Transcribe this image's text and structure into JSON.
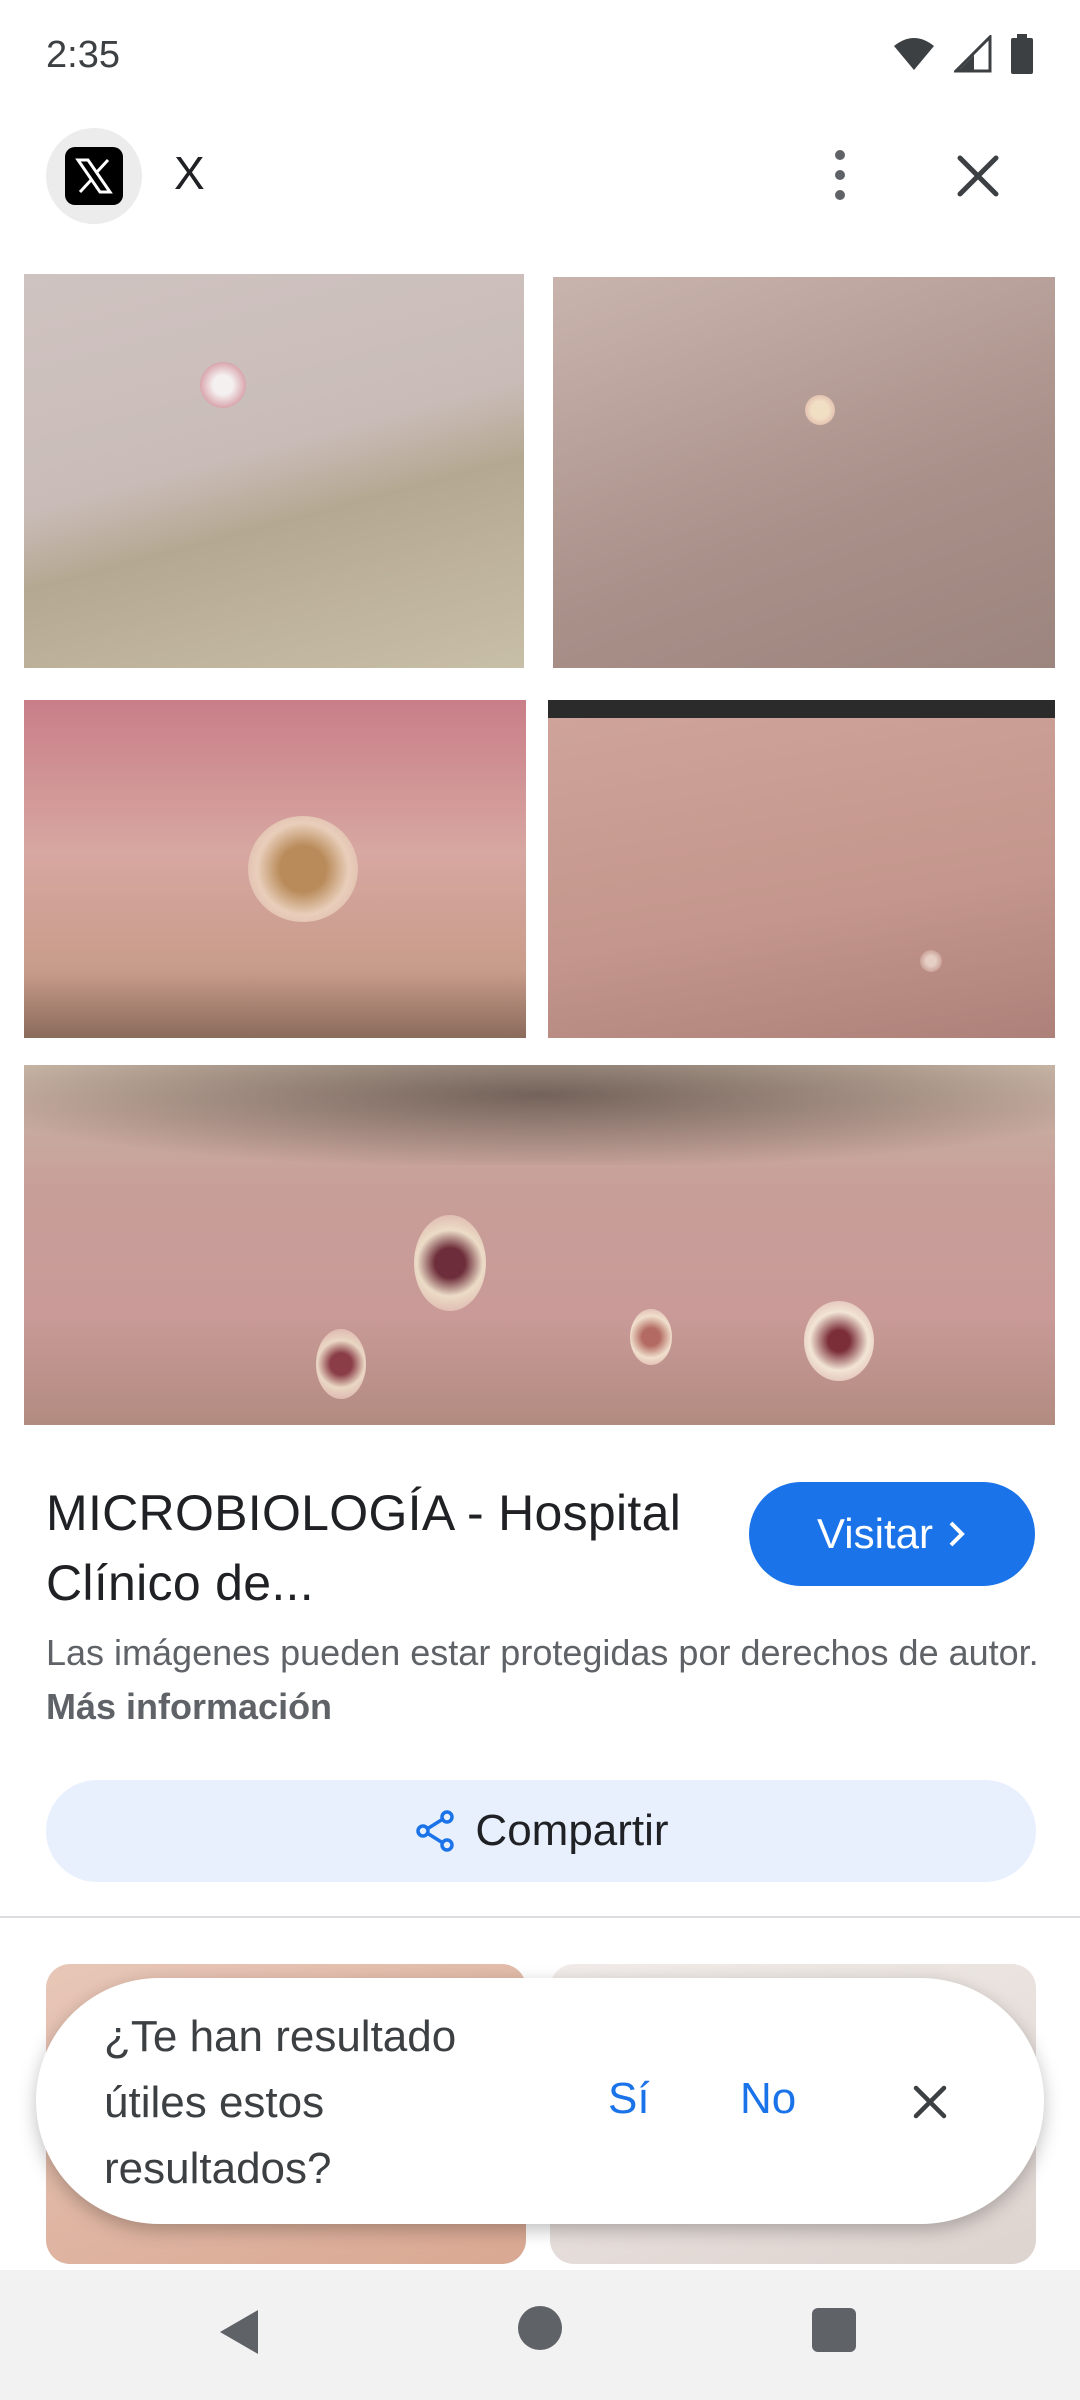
{
  "status_bar": {
    "time": "2:35",
    "icons": [
      "wifi-icon",
      "signal-icon",
      "battery-icon"
    ]
  },
  "header": {
    "source_name": "X",
    "source_icon": "x-logo-icon",
    "menu_icon": "more-vert-icon",
    "close_icon": "close-icon"
  },
  "images": [
    {
      "name": "lesion-photo-1"
    },
    {
      "name": "lesion-photo-2"
    },
    {
      "name": "lesion-photo-3"
    },
    {
      "name": "lesion-photo-4"
    },
    {
      "name": "lesion-photo-5"
    }
  ],
  "result": {
    "title": "MICROBIOLOGÍA - Hospital Clínico de...",
    "visit_label": "Visitar",
    "copyright_text": "Las imágenes pueden estar protegidas por derechos de autor.",
    "more_info_label": "Más información",
    "share_label": "Compartir"
  },
  "feedback": {
    "question": "¿Te han resultado útiles estos resultados?",
    "yes_label": "Sí",
    "no_label": "No"
  },
  "colors": {
    "accent": "#1a73e8",
    "share_bg": "#e8f0fe"
  }
}
